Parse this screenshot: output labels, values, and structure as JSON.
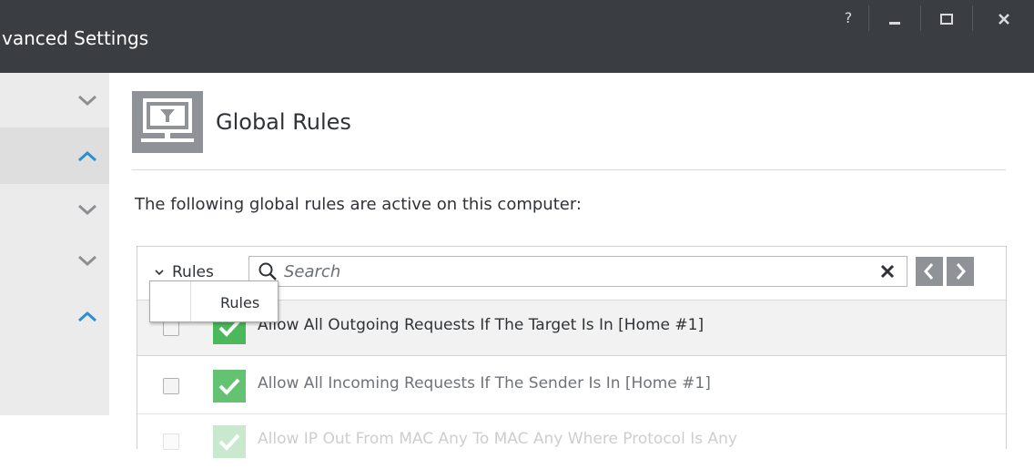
{
  "window": {
    "title": "vanced Settings",
    "help_label": "?",
    "colors": {
      "titlebar": "#3a3d42",
      "sidebar": "#ebebeb",
      "accent": "#2f8ecf",
      "status_green": "#4cb85c"
    }
  },
  "sidebar": {
    "items": [
      {
        "state": "collapsed"
      },
      {
        "state": "expanded"
      },
      {
        "state": "collapsed"
      },
      {
        "state": "collapsed"
      },
      {
        "state": "expanded"
      }
    ]
  },
  "main": {
    "title": "Global Rules",
    "icon": "monitor-filter-icon",
    "description": "The following global rules are active on this computer:"
  },
  "toolbar": {
    "filter_label": "Rules",
    "search_placeholder": "Search"
  },
  "dropdown": {
    "items": [
      "Rules"
    ]
  },
  "rules": [
    {
      "text": "Allow All Outgoing Requests If The Target Is In [Home #1]",
      "enabled": true
    },
    {
      "text": "Allow All Incoming Requests If The Sender Is In [Home #1]",
      "enabled": true
    },
    {
      "text": "Allow IP Out From MAC Any To MAC Any Where Protocol Is Any",
      "enabled": true
    }
  ]
}
